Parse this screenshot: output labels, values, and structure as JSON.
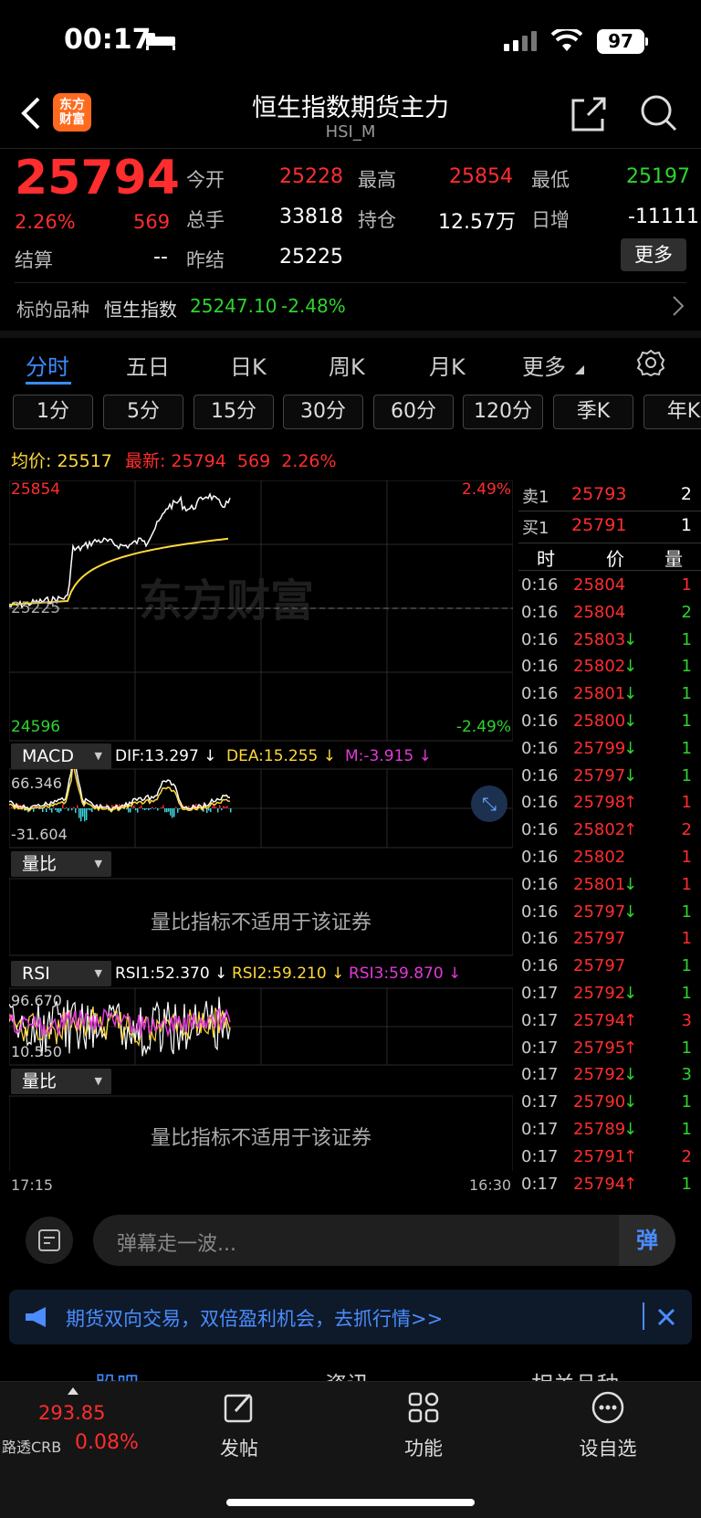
{
  "status": {
    "time": "00:17",
    "battery": "97"
  },
  "header": {
    "title": "恒生指数期货主力",
    "code": "HSI_M",
    "logo_line1": "东方",
    "logo_line2": "财富"
  },
  "quote": {
    "price": "25794",
    "pct": "2.26%",
    "change": "569",
    "open_label": "今开",
    "open": "25228",
    "high_label": "最高",
    "high": "25854",
    "low_label": "最低",
    "low": "25197",
    "volume_label": "总手",
    "volume": "33818",
    "oi_label": "持仓",
    "oi": "12.57万",
    "daily_label": "日增",
    "daily": "-11111",
    "settle_label": "结算",
    "settle": "--",
    "prev_label": "昨结",
    "prev": "25225",
    "more_button": "更多",
    "underlying_label": "标的品种",
    "underlying_name": "恒生指数",
    "underlying_price": "25247.10",
    "underlying_pct": "-2.48%"
  },
  "tabs": [
    "分时",
    "五日",
    "日K",
    "周K",
    "月K",
    "更多"
  ],
  "periods": [
    "1分",
    "5分",
    "15分",
    "30分",
    "60分",
    "120分",
    "季K",
    "年K"
  ],
  "chart": {
    "avg_label": "均价:",
    "avg": "25517",
    "latest_label": "最新:",
    "latest": "25794",
    "latest_chg": "569",
    "latest_pct": "2.26%",
    "top_price": "25854",
    "bottom_price": "24596",
    "mid_price": "25225",
    "top_pct": "2.49%",
    "bottom_pct": "-2.49%",
    "watermark": "东方财富",
    "start_time": "17:15",
    "end_time": "16:30",
    "macd_name": "MACD",
    "dif": "DIF:13.297 ↓",
    "dea": "DEA:15.255 ↓",
    "m": "M:-3.915 ↓",
    "macd_top": "66.346",
    "macd_bottom": "-31.604",
    "vol_ratio_name": "量比",
    "na_text": "量比指标不适用于该证券",
    "rsi_name": "RSI",
    "rsi1": "RSI1:52.370 ↓",
    "rsi2": "RSI2:59.210 ↓",
    "rsi3": "RSI3:59.870 ↓",
    "rsi_top": "96.670",
    "rsi_bottom": "10.550",
    "colors": {
      "up": "#ff2d2d",
      "down": "#2ed42e",
      "avg": "#ffd93a",
      "dea": "#ffd93a",
      "rsi3": "#e23ad8"
    }
  },
  "book": {
    "ask_label": "卖1",
    "ask_price": "25793",
    "ask_qty": "2",
    "bid_label": "买1",
    "bid_price": "25791",
    "bid_qty": "1",
    "col_time": "时",
    "col_price": "价",
    "col_qty": "量"
  },
  "trades": [
    {
      "t": "0:16",
      "p": "25804",
      "q": "1",
      "dir": "",
      "qc": "red"
    },
    {
      "t": "0:16",
      "p": "25804",
      "q": "2",
      "dir": "",
      "qc": "green"
    },
    {
      "t": "0:16",
      "p": "25803",
      "q": "1",
      "dir": "↓",
      "qc": "green"
    },
    {
      "t": "0:16",
      "p": "25802",
      "q": "1",
      "dir": "↓",
      "qc": "green"
    },
    {
      "t": "0:16",
      "p": "25801",
      "q": "1",
      "dir": "↓",
      "qc": "green"
    },
    {
      "t": "0:16",
      "p": "25800",
      "q": "1",
      "dir": "↓",
      "qc": "green"
    },
    {
      "t": "0:16",
      "p": "25799",
      "q": "1",
      "dir": "↓",
      "qc": "green"
    },
    {
      "t": "0:16",
      "p": "25797",
      "q": "1",
      "dir": "↓",
      "qc": "green"
    },
    {
      "t": "0:16",
      "p": "25798",
      "q": "1",
      "dir": "↑",
      "qc": "red"
    },
    {
      "t": "0:16",
      "p": "25802",
      "q": "2",
      "dir": "↑",
      "qc": "red"
    },
    {
      "t": "0:16",
      "p": "25802",
      "q": "1",
      "dir": "",
      "qc": "red"
    },
    {
      "t": "0:16",
      "p": "25801",
      "q": "1",
      "dir": "↓",
      "qc": "red"
    },
    {
      "t": "0:16",
      "p": "25797",
      "q": "1",
      "dir": "↓",
      "qc": "green"
    },
    {
      "t": "0:16",
      "p": "25797",
      "q": "1",
      "dir": "",
      "qc": "red"
    },
    {
      "t": "0:16",
      "p": "25797",
      "q": "1",
      "dir": "",
      "qc": "green"
    },
    {
      "t": "0:17",
      "p": "25792",
      "q": "1",
      "dir": "↓",
      "qc": "green"
    },
    {
      "t": "0:17",
      "p": "25794",
      "q": "3",
      "dir": "↑",
      "qc": "red"
    },
    {
      "t": "0:17",
      "p": "25795",
      "q": "1",
      "dir": "↑",
      "qc": "green"
    },
    {
      "t": "0:17",
      "p": "25792",
      "q": "3",
      "dir": "↓",
      "qc": "green"
    },
    {
      "t": "0:17",
      "p": "25790",
      "q": "1",
      "dir": "↓",
      "qc": "green"
    },
    {
      "t": "0:17",
      "p": "25789",
      "q": "1",
      "dir": "↓",
      "qc": "green"
    },
    {
      "t": "0:17",
      "p": "25791",
      "q": "2",
      "dir": "↑",
      "qc": "red"
    },
    {
      "t": "0:17",
      "p": "25794",
      "q": "1",
      "dir": "↑",
      "qc": "green"
    }
  ],
  "comment": {
    "placeholder": "弹幕走一波...",
    "danmu_button": "弹"
  },
  "banner": {
    "text": "期货双向交易，双倍盈利机会，去抓行情>>"
  },
  "behind_tabs": [
    "股吧",
    "资讯",
    "相关品种"
  ],
  "nav": {
    "crb_value": "293.85",
    "crb_name": "路透CRB",
    "crb_pct": "0.08%",
    "post": "发帖",
    "function": "功能",
    "watchlist": "设自选"
  }
}
